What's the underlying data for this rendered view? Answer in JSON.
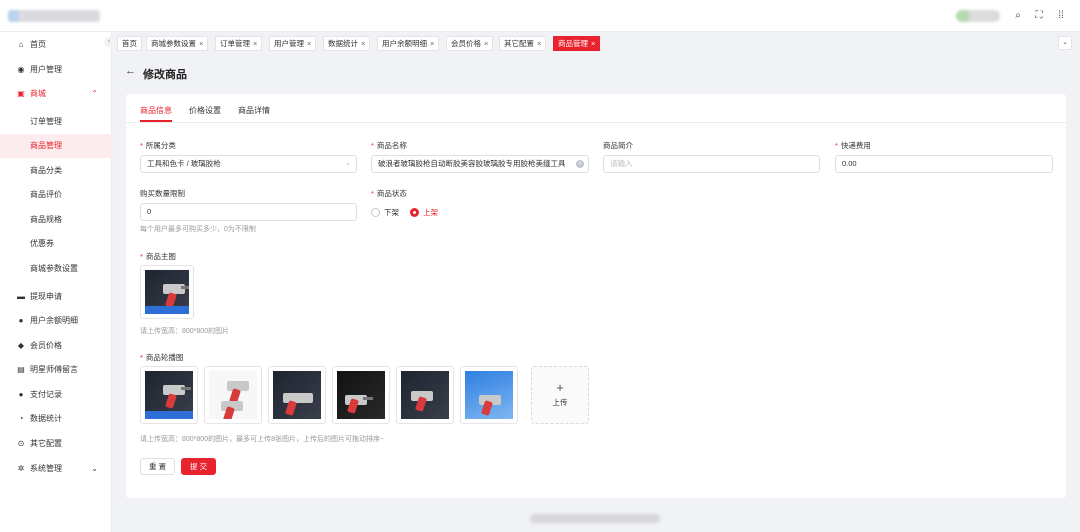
{
  "topbar": {
    "icons": [
      "search-icon",
      "fullscreen-icon",
      "grid-icon"
    ]
  },
  "sidebar": {
    "items": [
      {
        "label": "首页",
        "icon": "home-icon"
      },
      {
        "label": "用户管理",
        "icon": "user-icon"
      },
      {
        "label": "商城",
        "icon": "shop-icon",
        "expanded": true
      },
      {
        "label": "订单管理"
      },
      {
        "label": "商品管理",
        "active": true
      },
      {
        "label": "商品分类"
      },
      {
        "label": "商品评价"
      },
      {
        "label": "商品规格"
      },
      {
        "label": "优惠券"
      },
      {
        "label": "商城参数设置"
      },
      {
        "label": "提现申请",
        "icon": "wallet-icon"
      },
      {
        "label": "用户余额明细",
        "icon": "balance-icon"
      },
      {
        "label": "会员价格",
        "icon": "diamond-icon"
      },
      {
        "label": "明星师傅留言",
        "icon": "message-icon"
      },
      {
        "label": "支付记录",
        "icon": "pay-icon"
      },
      {
        "label": "数据统计",
        "icon": "chart-icon"
      },
      {
        "label": "其它配置",
        "icon": "config-icon"
      },
      {
        "label": "系统管理",
        "icon": "gear-icon"
      }
    ]
  },
  "tabs": [
    "首页",
    "商城参数设置",
    "订单管理",
    "用户管理",
    "数据统计",
    "用户余额明细",
    "会员价格",
    "其它配置",
    "商品管理"
  ],
  "page": {
    "title": "修改商品"
  },
  "card_tabs": [
    "商品信息",
    "价格设置",
    "商品详情"
  ],
  "form": {
    "category_label": "所属分类",
    "category_value": "工具和色卡 / 玻璃胶枪",
    "name_label": "商品名称",
    "name_value": "破浪者玻璃胶枪自动断胶美容胶玻璃胶专用胶枪美缝工具",
    "intro_label": "商品简介",
    "intro_placeholder": "请输入",
    "shipping_label": "快递费用",
    "shipping_value": "0.00",
    "limit_label": "购买数量限制",
    "limit_value": "0",
    "limit_hint": "每个用户最多可购买多少，0为不限制",
    "status_label": "商品状态",
    "status_off": "下架",
    "status_on": "上架",
    "main_image_label": "商品主图",
    "main_image_hint": "请上传宽高：800*800的图片",
    "carousel_label": "商品轮播图",
    "carousel_hint": "请上传宽高：800*800的图片，最多可上传8张图片，上传后的图片可拖动排序~",
    "upload_label": "上传",
    "reset_label": "重 置",
    "submit_label": "提 交"
  },
  "colors": {
    "accent": "#e8232d"
  }
}
